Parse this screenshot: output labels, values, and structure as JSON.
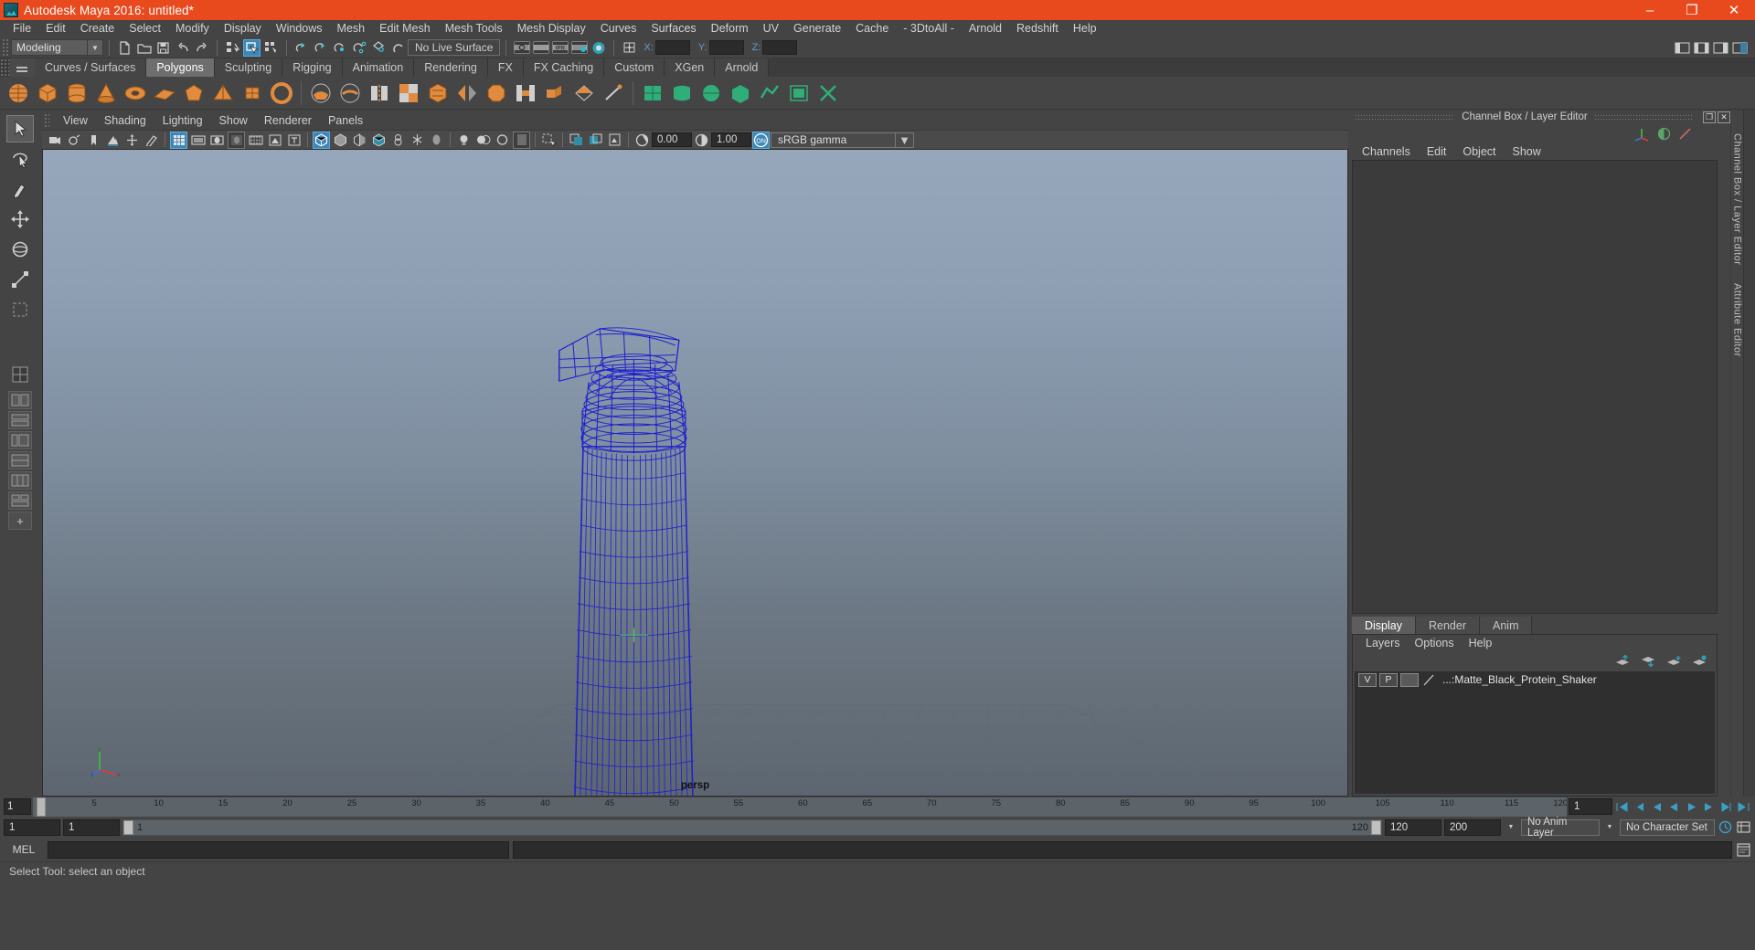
{
  "window": {
    "title": "Autodesk Maya 2016: untitled*",
    "icon": "maya-logo-icon",
    "minimize": "–",
    "maximize": "❐",
    "close": "✕",
    "titlebar_color": "#e8491d"
  },
  "menubar": {
    "items": [
      "File",
      "Edit",
      "Create",
      "Select",
      "Modify",
      "Display",
      "Windows",
      "Mesh",
      "Edit Mesh",
      "Mesh Tools",
      "Mesh Display",
      "Curves",
      "Surfaces",
      "Deform",
      "UV",
      "Generate",
      "Cache",
      "- 3DtoAll -",
      "Arnold",
      "Redshift",
      "Help"
    ]
  },
  "toolbar": {
    "mode": "Modeling",
    "mode_arrow": "▼",
    "live_surface": "No Live Surface",
    "axis_x": "X:",
    "axis_y": "Y:",
    "axis_z": "Z:",
    "x_value": "",
    "y_value": "",
    "z_value": "",
    "icons": [
      "new-scene-icon",
      "open-scene-icon",
      "save-scene-icon",
      "undo-icon",
      "redo-icon",
      "select-by-hierarchy-icon",
      "select-by-object-icon",
      "select-by-component-icon",
      "snap-to-grid-icon",
      "snap-to-curve-icon",
      "snap-to-point-icon",
      "snap-to-projected-center-icon",
      "snap-to-view-plane-icon",
      "make-live-icon",
      "render-view-icon",
      "render-current-frame-icon",
      "ipr-render-icon",
      "render-settings-icon",
      "hypershade-icon",
      "input-output-icon"
    ],
    "right_icons": [
      "sidebar-left-icon",
      "sidebar-both-icon",
      "sidebar-right-icon",
      "attribute-editor-icon"
    ]
  },
  "shelf": {
    "tabs": [
      "Curves / Surfaces",
      "Polygons",
      "Sculpting",
      "Rigging",
      "Animation",
      "Rendering",
      "FX",
      "FX Caching",
      "Custom",
      "XGen",
      "Arnold"
    ],
    "active_tab": "Polygons",
    "icon_count": 26
  },
  "viewport": {
    "menus": [
      "View",
      "Shading",
      "Lighting",
      "Show",
      "Renderer",
      "Panels"
    ],
    "exposure_value": "0.00",
    "gamma_value": "1.00",
    "color_management_toggle": "ON",
    "color_profile": "sRGB gamma",
    "color_profile_arrow": "▼",
    "camera_label": "persp",
    "wireframe_color": "#2020d0",
    "bg_top": "#96a7bb",
    "bg_bottom": "#5d6670",
    "model_name": "protein-shaker-wireframe",
    "axis_labels": {
      "x": "x",
      "y": "y",
      "z": "z"
    }
  },
  "toolbox": {
    "tools": [
      "select-tool",
      "lasso-select-tool",
      "paint-select-tool",
      "move-tool",
      "rotate-tool",
      "scale-tool",
      "last-tool-used"
    ],
    "selected": "select-tool",
    "layout_buttons": [
      "single-perspective-layout",
      "four-view-layout",
      "outliner-persp-layout",
      "persp-graph-layout",
      "hypershade-persp-layout",
      "persp-layout-extra",
      "multi-panel-layout",
      "expand-layout"
    ]
  },
  "channel_box": {
    "panel_title": "Channel Box / Layer Editor",
    "undock_btn": "❐",
    "close_btn": "✕",
    "menus": [
      "Channels",
      "Edit",
      "Object",
      "Show"
    ],
    "tool_icons": [
      "manipulator-icon",
      "shading-icon",
      "attributes-icon"
    ],
    "content": ""
  },
  "layer_editor": {
    "tabs": [
      "Display",
      "Render",
      "Anim"
    ],
    "active_tab": "Display",
    "menus": [
      "Layers",
      "Options",
      "Help"
    ],
    "tool_icons": [
      "move-layer-up-icon",
      "move-layer-down-icon",
      "new-layer-icon",
      "new-layer-from-selected-icon"
    ],
    "layers": [
      {
        "visibility": "V",
        "playback": "P",
        "color": "",
        "name": "...:Matte_Black_Protein_Shaker"
      }
    ]
  },
  "side_tabs": [
    "Channel Box / Layer Editor",
    "Attribute Editor"
  ],
  "timeline": {
    "current_frame_field": "1",
    "ticks": [
      "5",
      "10",
      "15",
      "20",
      "25",
      "30",
      "35",
      "40",
      "45",
      "50",
      "55",
      "60",
      "65",
      "70",
      "75",
      "80",
      "85",
      "90",
      "95",
      "100",
      "105",
      "110",
      "115",
      "120"
    ],
    "playback_frame": "1",
    "playback_buttons": [
      "go-to-start-icon",
      "step-back-frame-icon",
      "step-back-key-icon",
      "play-backwards-icon",
      "play-forwards-icon",
      "step-forward-key-icon",
      "step-forward-frame-icon",
      "go-to-end-icon"
    ],
    "range_start": "1",
    "range_start2": "1",
    "range_slider_label": "1",
    "range_slider_end": "120",
    "range_end": "120",
    "playback_end": "200",
    "anim_layer": "No Anim Layer",
    "anim_layer_arrow": "▼",
    "character_set": "No Character Set",
    "auto_key_icon": "auto-keyframe-icon",
    "anim_prefs_icon": "animation-preferences-icon"
  },
  "command_line": {
    "label": "MEL",
    "input_value": "",
    "output_value": "",
    "script_editor_icon": "script-editor-icon"
  },
  "status": {
    "message": "Select Tool: select an object"
  }
}
